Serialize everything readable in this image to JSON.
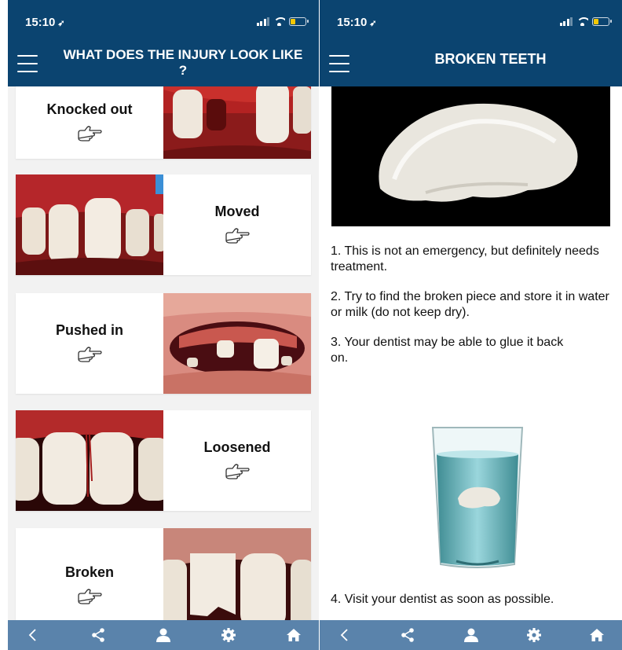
{
  "status_bar": {
    "time": "15:10"
  },
  "left_screen": {
    "title": "WHAT DOES THE INJURY LOOK LIKE ?",
    "cards": [
      {
        "label": "Knocked out",
        "layout": "text-left"
      },
      {
        "label": "Moved",
        "layout": "image-left"
      },
      {
        "label": "Pushed in",
        "layout": "text-left"
      },
      {
        "label": "Loosened",
        "layout": "image-left"
      },
      {
        "label": "Broken",
        "layout": "text-left"
      }
    ]
  },
  "right_screen": {
    "title": "BROKEN TEETH",
    "steps": [
      "1. This is not an emergency, but definitely needs treatment.",
      "2. Try to find the broken piece and store it in water or milk (do not keep dry).",
      "3. Your dentist may be able to glue it back on.",
      "4. Visit your dentist as soon as possible."
    ]
  },
  "bottom_tabs": [
    "back-icon",
    "share-icon",
    "profile-icon",
    "settings-icon",
    "home-icon"
  ],
  "colors": {
    "header": "#0b4470",
    "tabbar": "#5a83ab",
    "card_bg": "#ffffff",
    "list_bg": "#f2f2f2"
  }
}
